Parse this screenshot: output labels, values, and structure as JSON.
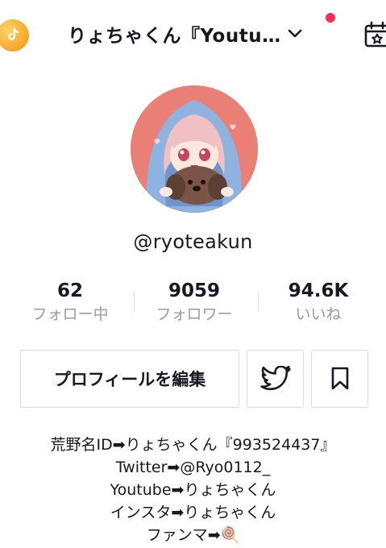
{
  "header": {
    "title": "りょちゃくん『Youtu…",
    "coin_icon": "tiktok-coin-icon",
    "dropdown_icon": "chevron-down-icon",
    "calendar_icon": "calendar-star-icon",
    "notification_dot_color": "#fe2c55"
  },
  "profile": {
    "username": "@ryoteakun",
    "avatar_icon": "anime-avatar-image"
  },
  "stats": [
    {
      "value": "62",
      "label": "フォロー中"
    },
    {
      "value": "9059",
      "label": "フォロワー"
    },
    {
      "value": "94.6K",
      "label": "いいね"
    }
  ],
  "buttons": {
    "edit_label": "プロフィールを編集",
    "twitter_icon": "twitter-icon",
    "bookmark_icon": "bookmark-icon"
  },
  "bio": [
    "荒野名ID➡りょちゃくん『993524437』",
    "Twitter➡@Ryo0112_",
    "Youtube➡りょちゃくん",
    "インスタ➡りょちゃくん",
    "ファンマ➡🍭"
  ]
}
